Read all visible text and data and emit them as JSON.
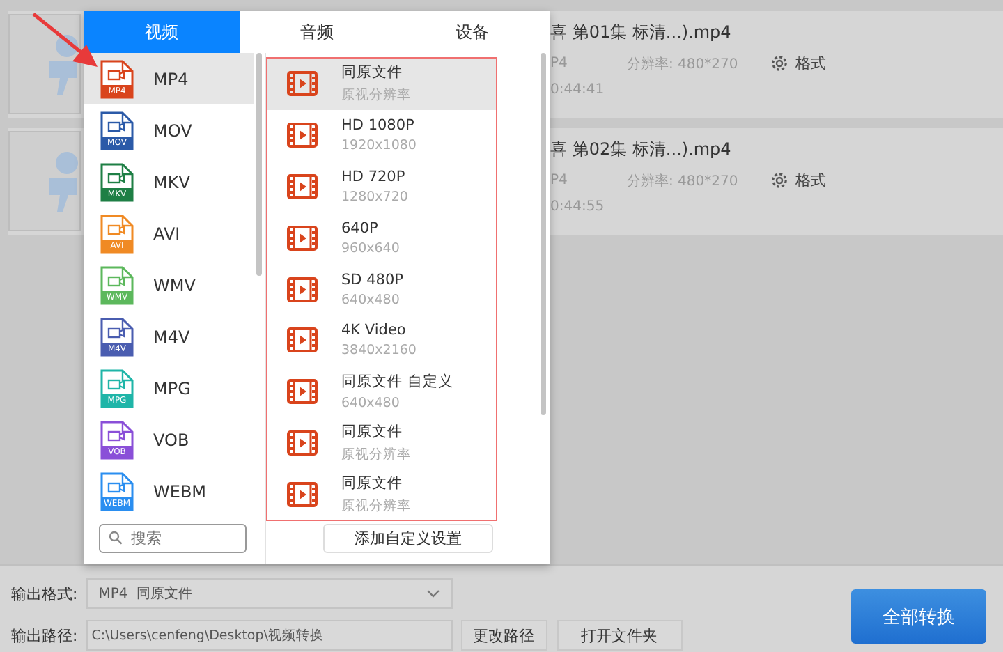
{
  "tabs": [
    {
      "label": "视频",
      "selected": true
    },
    {
      "label": "音频",
      "selected": false
    },
    {
      "label": "设备",
      "selected": false
    }
  ],
  "formats": [
    {
      "name": "MP4",
      "icon_label": "MP4",
      "color": "#d9441c",
      "selected": true
    },
    {
      "name": "MOV",
      "icon_label": "MOV",
      "color": "#2b5aa8",
      "selected": false
    },
    {
      "name": "MKV",
      "icon_label": "MKV",
      "color": "#1e7f45",
      "selected": false
    },
    {
      "name": "AVI",
      "icon_label": "AVI",
      "color": "#f08a24",
      "selected": false
    },
    {
      "name": "WMV",
      "icon_label": "WMV",
      "color": "#5cb85c",
      "selected": false
    },
    {
      "name": "M4V",
      "icon_label": "M4V",
      "color": "#4a5db0",
      "selected": false
    },
    {
      "name": "MPG",
      "icon_label": "MPG",
      "color": "#1fb5a8",
      "selected": false
    },
    {
      "name": "VOB",
      "icon_label": "VOB",
      "color": "#8a4fd8",
      "selected": false
    },
    {
      "name": "WEBM",
      "icon_label": "WEBM",
      "color": "#2a8ef0",
      "selected": false
    }
  ],
  "search": {
    "placeholder": "搜索"
  },
  "presets": [
    {
      "title": "同原文件",
      "detail": "原视分辨率",
      "selected": true
    },
    {
      "title": "HD 1080P",
      "detail": "1920x1080",
      "selected": false
    },
    {
      "title": "HD 720P",
      "detail": "1280x720",
      "selected": false
    },
    {
      "title": "640P",
      "detail": "960x640",
      "selected": false
    },
    {
      "title": "SD 480P",
      "detail": "640x480",
      "selected": false
    },
    {
      "title": "4K Video",
      "detail": "3840x2160",
      "selected": false
    },
    {
      "title": "同原文件 自定义",
      "detail": "640x480",
      "selected": false
    },
    {
      "title": "同原文件",
      "detail": "原视分辨率",
      "selected": false
    },
    {
      "title": "同原文件",
      "detail": "原视分辨率",
      "selected": false
    }
  ],
  "add_custom_button": "添加自定义设置",
  "files": [
    {
      "title": "喜 第01集 标清...).mp4",
      "format": "P4",
      "resolution": "分辨率: 480*270",
      "settings": "格式",
      "duration": "0:44:41"
    },
    {
      "title": "喜 第02集 标清...).mp4",
      "format": "P4",
      "resolution": "分辨率: 480*270",
      "settings": "格式",
      "duration": "0:44:55"
    }
  ],
  "output": {
    "format_label": "输出格式:",
    "format_value": "MP4  同原文件",
    "path_label": "输出路径:",
    "path_value": "C:\\Users\\cenfeng\\Desktop\\视频转换",
    "change_path_button": "更改路径",
    "open_folder_button": "打开文件夹"
  },
  "convert_all_button": "全部转换"
}
